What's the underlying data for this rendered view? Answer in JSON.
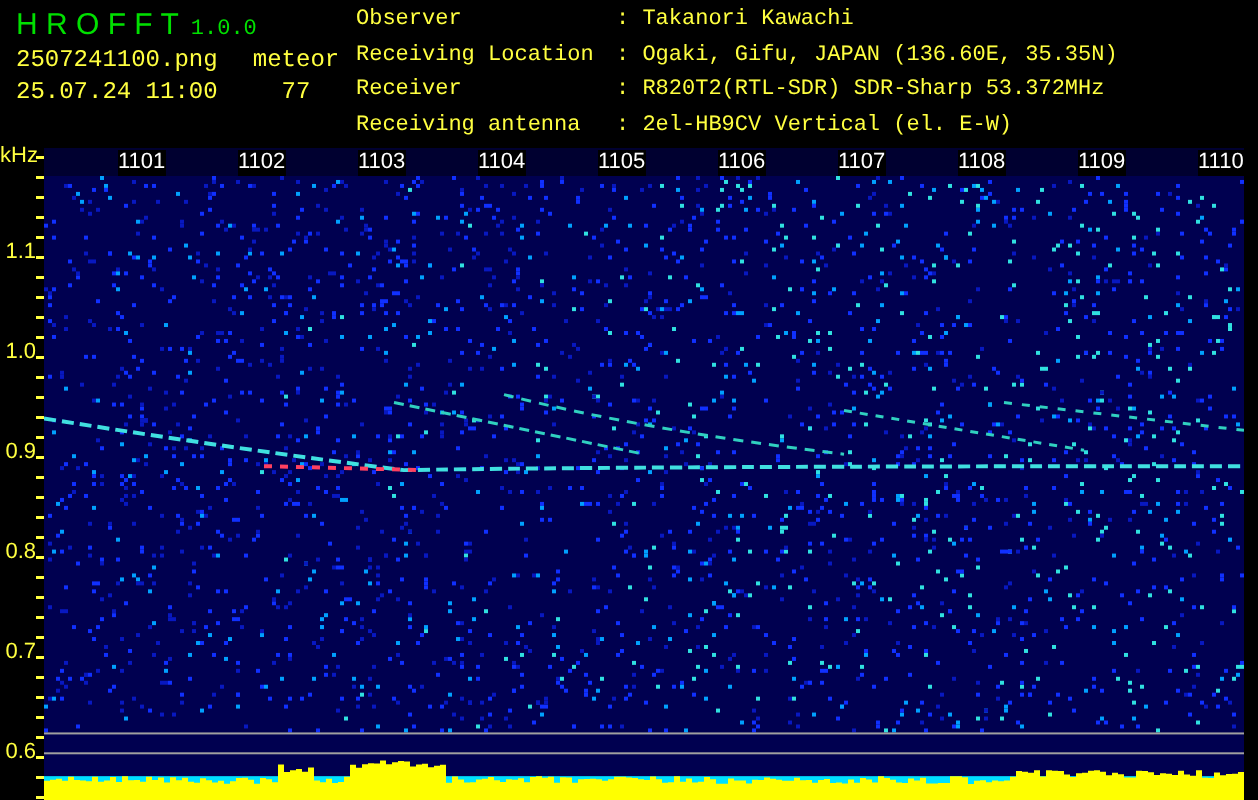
{
  "app": {
    "name": "H R O F F T",
    "version": "1.0.0"
  },
  "file": "2507241100.png",
  "timestamp": "25.07.24 11:00",
  "meteor": {
    "label": "meteor",
    "count": "77"
  },
  "info": [
    {
      "label": "Observer",
      "value": ": Takanori Kawachi"
    },
    {
      "label": "Receiving Location",
      "value": ": Ogaki, Gifu, JAPAN (136.60E, 35.35N)"
    },
    {
      "label": "Receiver",
      "value": ": R820T2(RTL-SDR) SDR-Sharp 53.372MHz"
    },
    {
      "label": "Receiving antenna",
      "value": ": 2el-HB9CV Vertical (el. E-W)"
    }
  ],
  "axis": {
    "unit": "kHz",
    "y_labels": [
      "1.1",
      "1.0",
      "0.9",
      "0.8",
      "0.7",
      "0.6"
    ],
    "x_labels": [
      "1101",
      "1102",
      "1103",
      "1104",
      "1105",
      "1106",
      "1107",
      "1108",
      "1109",
      "1110"
    ]
  }
}
